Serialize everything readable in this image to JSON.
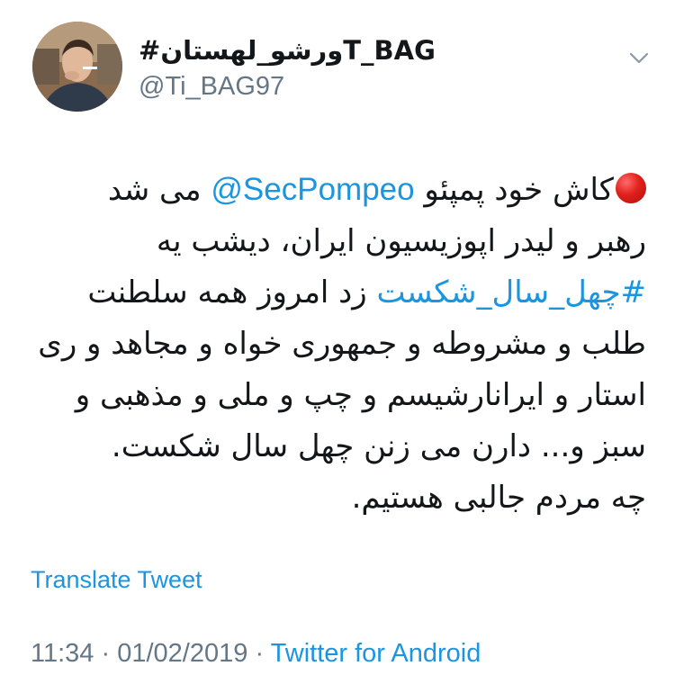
{
  "author": {
    "display_name": "#ورشو_لهستانT_BAG",
    "handle": "@Ti_BAG97"
  },
  "tweet": {
    "emoji": "red-circle",
    "lines": [
      {
        "pre": "کاش خود پمپئو ",
        "mention": "@SecPompeo",
        "post": " می شد"
      },
      {
        "text": "رهبر و لیدر اپوزیسیون ایران، دیشب یه"
      },
      {
        "hashtag": "#چهل_سال_شکست",
        "post": " زد امروز همه سلطنت"
      },
      {
        "text": "طلب و مشروطه و جمهوری خواه و مجاهد و ری"
      },
      {
        "text": "استار و ایرانارشیسم و چپ و ملی و مذهبی و"
      },
      {
        "text": "سبز و... دارن می زنن چهل سال شکست."
      },
      {
        "text": "چه مردم جالبی هستیم."
      }
    ]
  },
  "translate_label": "Translate Tweet",
  "meta": {
    "time": "11:34",
    "separator": "·",
    "date": "01/02/2019",
    "source": "Twitter for Android"
  },
  "icons": {
    "menu": "chevron-down-icon",
    "status": "red-circle-emoji"
  },
  "colors": {
    "link": "#1b95e0",
    "text": "#14171a",
    "muted": "#657786",
    "emoji_red": "#e0201b"
  }
}
